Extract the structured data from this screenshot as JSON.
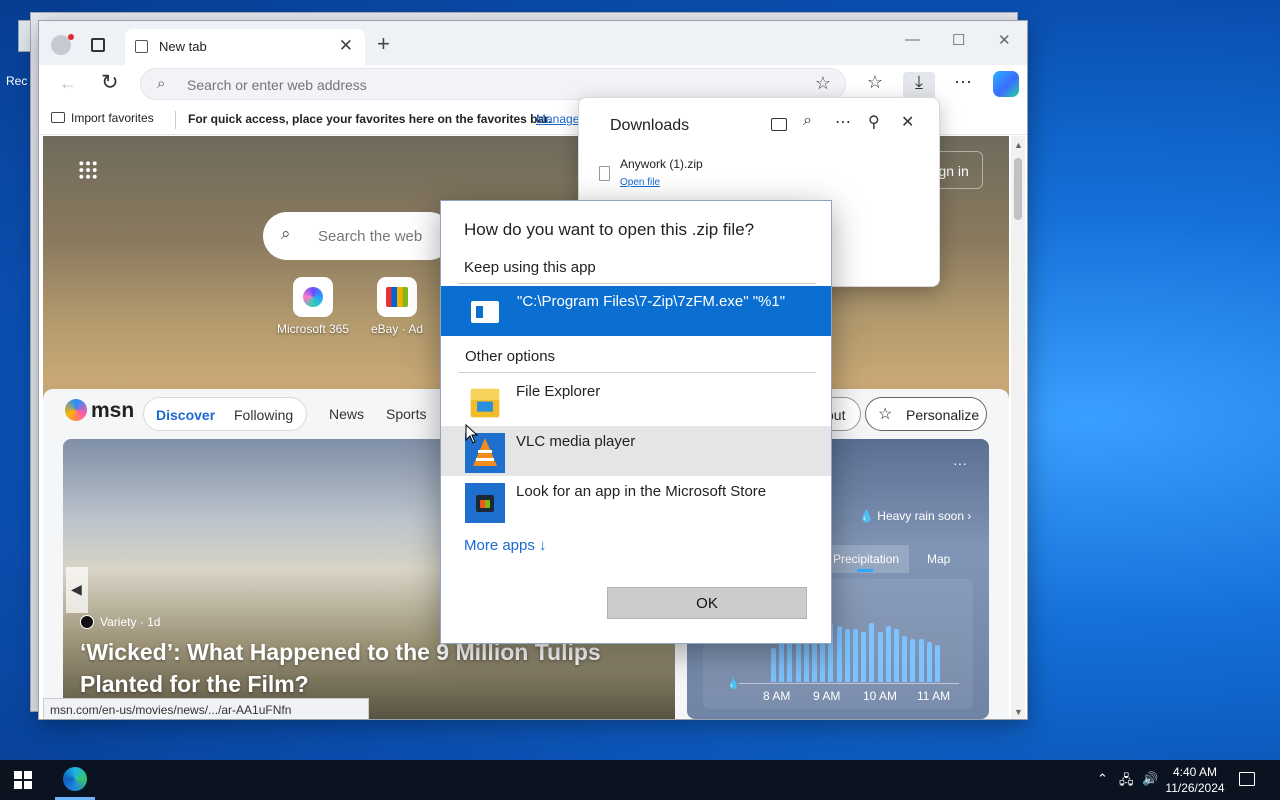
{
  "desktop": {
    "icon_label": "Rec"
  },
  "browser": {
    "tab_title": "New tab",
    "address_placeholder": "Search or enter web address",
    "favbar": {
      "import_label": "Import favorites",
      "hint": "For quick access, place your favorites here on the favorites bar.",
      "manage_link": "Manage"
    },
    "newtab": {
      "signin_label": "Sign in",
      "search_placeholder": "Search the web",
      "quick_links": [
        {
          "label": "Microsoft 365"
        },
        {
          "label": "eBay · Ad"
        }
      ],
      "feed": {
        "logo": "msn",
        "tabs": [
          "Discover",
          "Following",
          "News",
          "Sports"
        ],
        "partial_pill": "out",
        "personalize": "Personalize",
        "hero": {
          "source": "Variety · 1d",
          "title": "‘Wicked’: What Happened to the 9 Million Tulips Planted for the Film?"
        },
        "weather": {
          "alert": "Heavy rain soon",
          "tabs": [
            "Precipitation",
            "Map"
          ],
          "chart_data": {
            "type": "bar",
            "x_labels": [
              "8 AM",
              "9 AM",
              "10 AM",
              "11 AM"
            ],
            "values": [
              0.55,
              0.85,
              0.85,
              0.9,
              0.9,
              0.85,
              0.9,
              0.95,
              0.9,
              0.85,
              0.85,
              0.8,
              0.95,
              0.8,
              0.9,
              0.85,
              0.75,
              0.7,
              0.7,
              0.65,
              0.6
            ],
            "ylim": [
              0,
              1
            ],
            "color": "#7cc3ff"
          }
        }
      },
      "status_url": "msn.com/en-us/movies/news/.../ar-AA1uFNfn"
    }
  },
  "downloads": {
    "title": "Downloads",
    "item": {
      "name": "Anywork (1).zip",
      "action": "Open file"
    }
  },
  "dialog": {
    "title": "How do you want to open this .zip file?",
    "keep_section": "Keep using this app",
    "selected_app": "\"C:\\Program Files\\7-Zip\\7zFM.exe\" \"%1\"",
    "other_section": "Other options",
    "options": [
      {
        "label": "File Explorer",
        "icon": "folder-icon"
      },
      {
        "label": "VLC media player",
        "icon": "vlc-icon"
      },
      {
        "label": "Look for an app in the Microsoft Store",
        "icon": "store-icon"
      }
    ],
    "more_apps": "More apps",
    "ok_label": "OK"
  },
  "taskbar": {
    "time": "4:40 AM",
    "date": "11/26/2024"
  }
}
